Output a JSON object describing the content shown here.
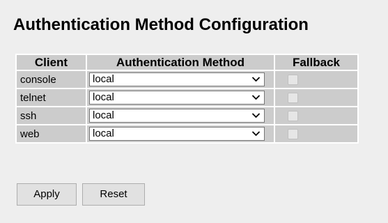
{
  "title": "Authentication Method Configuration",
  "table": {
    "headers": {
      "client": "Client",
      "method": "Authentication Method",
      "fallback": "Fallback"
    },
    "rows": [
      {
        "client": "console",
        "method": "local",
        "fallback": false
      },
      {
        "client": "telnet",
        "method": "local",
        "fallback": false
      },
      {
        "client": "ssh",
        "method": "local",
        "fallback": false
      },
      {
        "client": "web",
        "method": "local",
        "fallback": false
      }
    ]
  },
  "buttons": {
    "apply": "Apply",
    "reset": "Reset"
  }
}
